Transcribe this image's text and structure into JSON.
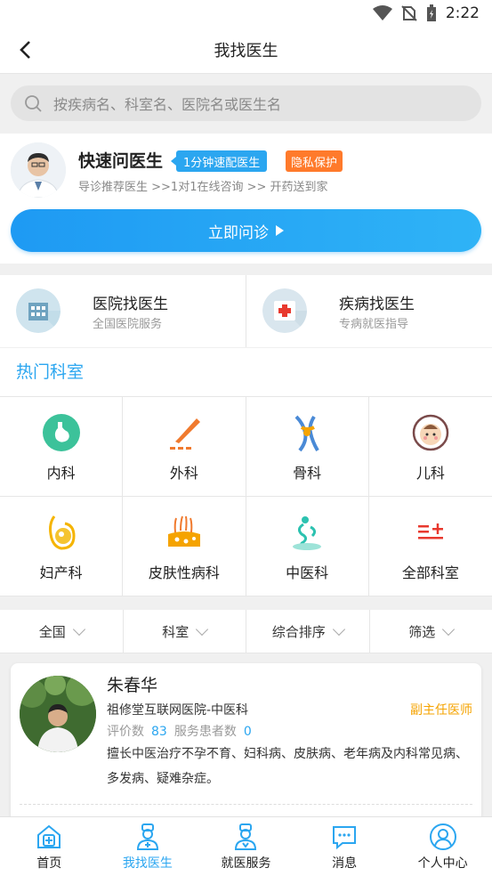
{
  "status_bar": {
    "time": "2:22"
  },
  "header": {
    "title": "我找医生"
  },
  "search": {
    "placeholder": "按疾病名、科室名、医院名或医生名"
  },
  "quick_consult": {
    "title": "快速问医生",
    "tag_match": "1分钟速配医生",
    "tag_privacy": "隐私保护",
    "subtitle": "导诊推荐医生 >>1对1在线咨询 >> 开药送到家",
    "cta_label": "立即问诊"
  },
  "finders": [
    {
      "title": "医院找医生",
      "subtitle": "全国医院服务",
      "icon": "hospital-icon"
    },
    {
      "title": "疾病找医生",
      "subtitle": "专病就医指导",
      "icon": "medical-cross-icon"
    }
  ],
  "hot_departments": {
    "title": "热门科室",
    "items": [
      {
        "label": "内科",
        "icon": "stomach-icon"
      },
      {
        "label": "外科",
        "icon": "scalpel-icon"
      },
      {
        "label": "骨科",
        "icon": "bone-joint-icon"
      },
      {
        "label": "儿科",
        "icon": "baby-face-icon"
      },
      {
        "label": "妇产科",
        "icon": "pregnancy-icon"
      },
      {
        "label": "皮肤性病科",
        "icon": "skin-hair-icon"
      },
      {
        "label": "中医科",
        "icon": "tcm-icon"
      },
      {
        "label": "全部科室",
        "icon": "all-departments-icon"
      }
    ]
  },
  "filters": [
    {
      "label": "全国"
    },
    {
      "label": "科室"
    },
    {
      "label": "综合排序"
    },
    {
      "label": "筛选"
    }
  ],
  "doctor_card": {
    "name": "朱春华",
    "hospital": "祖修堂互联网医院-中医科",
    "rank": "副主任医师",
    "rating_label": "评价数",
    "rating_count": "83",
    "patients_label": "服务患者数",
    "patients_count": "0",
    "description": "擅长中医治疗不孕不育、妇科病、皮肤病、老年病及内科常见病、多发病、疑难杂症。"
  },
  "tab_bar": {
    "items": [
      {
        "label": "首页",
        "icon": "home-plus-icon",
        "active": false
      },
      {
        "label": "我找医生",
        "icon": "doctor-icon",
        "active": true
      },
      {
        "label": "就医服务",
        "icon": "nurse-icon",
        "active": false
      },
      {
        "label": "消息",
        "icon": "message-icon",
        "active": false
      },
      {
        "label": "个人中心",
        "icon": "user-icon",
        "active": false
      }
    ]
  },
  "colors": {
    "accent": "#2ba6f0",
    "orange": "#ff7a2b",
    "rank": "#f5a300"
  }
}
